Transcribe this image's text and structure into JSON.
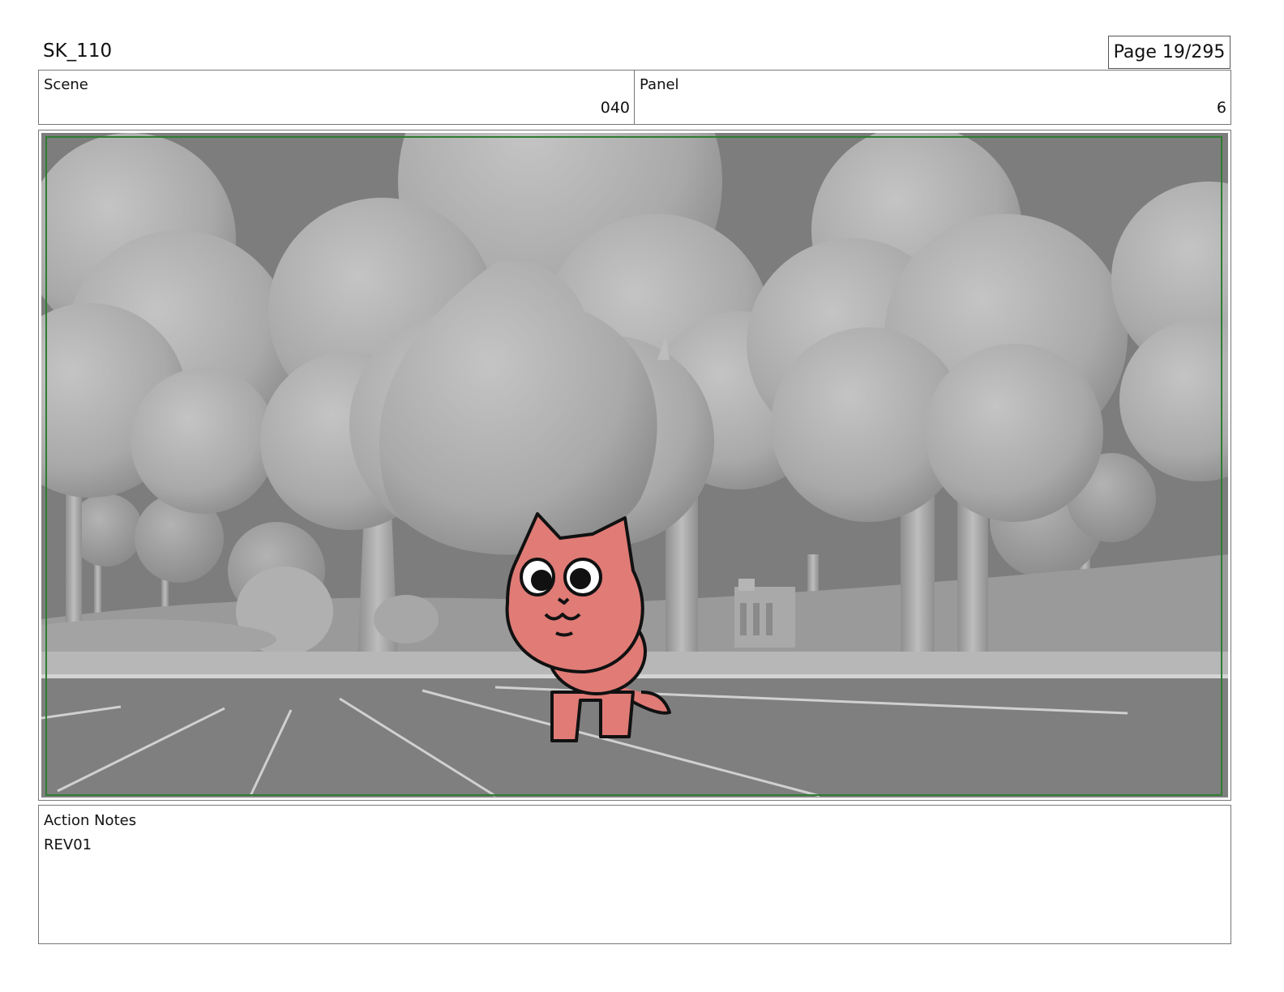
{
  "header": {
    "title": "SK_110",
    "page_label": "Page",
    "page_number": "19/295"
  },
  "fields": {
    "scene": {
      "label": "Scene",
      "value": "040"
    },
    "panel": {
      "label": "Panel",
      "value": "6"
    }
  },
  "frame": {
    "safe_frame_color": "#2e7d32",
    "background_color": "#7d7d7d",
    "character_color": "#e07b76"
  },
  "notes": {
    "label": "Action Notes",
    "text": "REV01"
  }
}
